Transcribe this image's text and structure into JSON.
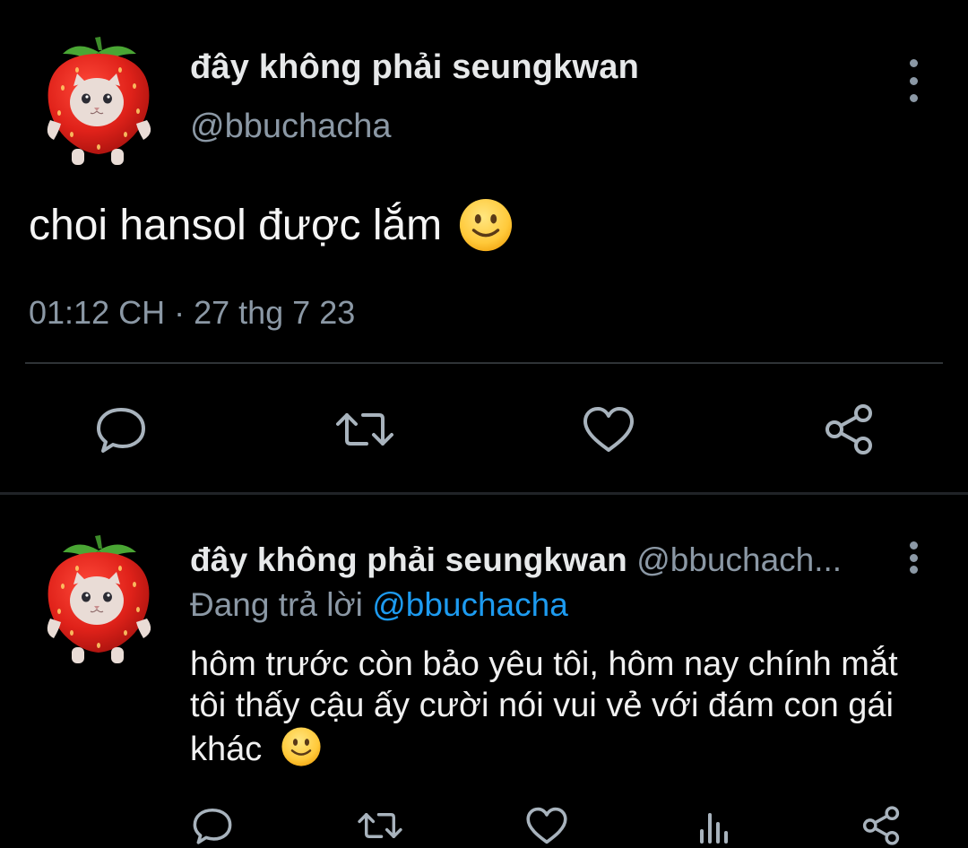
{
  "main_tweet": {
    "author": {
      "display_name": "đây không phải seungkwan",
      "handle": "@bbuchacha",
      "avatar": "strawberry-cat-avatar"
    },
    "text": "choi hansol được lắm",
    "emoji": "slightly-smiling-face",
    "meta": "01:12 CH · 27 thg 7 23",
    "actions": [
      "reply-icon",
      "retweet-icon",
      "like-icon",
      "share-icon"
    ]
  },
  "reply_tweet": {
    "author": {
      "display_name": "đây không phải seungkwan",
      "handle": "@bbuchach...",
      "avatar": "strawberry-cat-avatar"
    },
    "replying_prefix": "Đang trả lời",
    "replying_to": "@bbuchacha",
    "text": "hôm trước còn bảo yêu tôi, hôm nay chính mắt tôi thấy cậu ấy cười nói vui vẻ với đám con gái khác",
    "emoji": "slightly-smiling-face",
    "actions": [
      "reply-icon",
      "retweet-icon",
      "like-icon",
      "views-icon",
      "share-icon"
    ]
  },
  "colors": {
    "background": "#000000",
    "text": "#e7e9ea",
    "secondary": "#8b98a5",
    "accent": "#1d9bf0",
    "divider": "#2f3336"
  }
}
